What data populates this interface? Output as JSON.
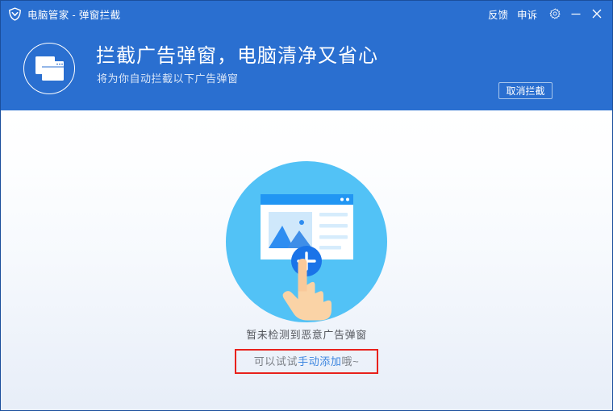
{
  "window": {
    "titlebar": {
      "logo_icon": "shield-icon",
      "title": "电脑管家 - 弹窗拦截",
      "feedback_label": "反馈",
      "appeal_label": "申诉",
      "settings_icon": "gear-icon",
      "minimize_icon": "minimize-icon",
      "close_icon": "close-icon"
    },
    "banner": {
      "icon": "stacked-windows-icon",
      "title": "拦截广告弹窗，电脑清净又省心",
      "subtitle": "将为你自动拦截以下广告弹窗",
      "cancel_button_label": "取消拦截"
    },
    "main": {
      "illustration": "add-popup-illustration",
      "status_text": "暂未检测到恶意广告弹窗",
      "hint": {
        "prefix": "可以试试",
        "link": "手动添加",
        "suffix": "哦~"
      }
    },
    "colors": {
      "header_blue": "#2a6fd0",
      "border_blue": "#1b4f9c",
      "link_blue": "#3d86e0",
      "highlight_red": "#e8211c",
      "illustration_circle": "#52c2f6",
      "plus_button_blue": "#1a73e8",
      "body_bottom": "#e7eef8"
    }
  }
}
